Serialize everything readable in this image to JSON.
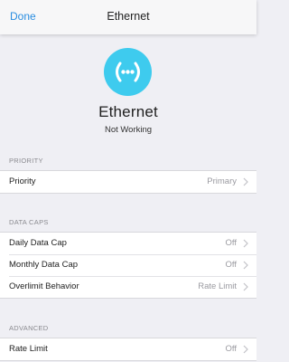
{
  "nav": {
    "done_label": "Done",
    "title": "Ethernet"
  },
  "hero": {
    "icon": "ethernet-dots-icon",
    "icon_color": "#3ecbee",
    "name": "Ethernet",
    "status": "Not Working"
  },
  "sections": {
    "priority": {
      "header": "PRIORITY",
      "rows": [
        {
          "label": "Priority",
          "value": "Primary"
        }
      ]
    },
    "data_caps": {
      "header": "DATA CAPS",
      "rows": [
        {
          "label": "Daily Data Cap",
          "value": "Off"
        },
        {
          "label": "Monthly Data Cap",
          "value": "Off"
        },
        {
          "label": "Overlimit Behavior",
          "value": "Rate Limit"
        }
      ]
    },
    "advanced": {
      "header": "ADVANCED",
      "rows": [
        {
          "label": "Rate Limit",
          "value": "Off"
        }
      ]
    }
  },
  "colors": {
    "accent": "#2a8de0",
    "background": "#efeff4"
  }
}
